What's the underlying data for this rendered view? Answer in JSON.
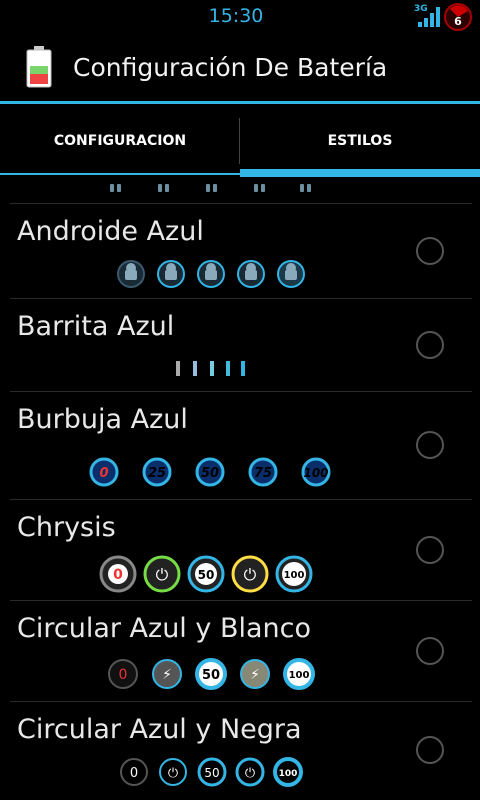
{
  "status_bar": {
    "time": "15:30",
    "network": "3G",
    "notification_count": "6"
  },
  "action_bar": {
    "title": "Configuración De Batería",
    "icon": "battery-icon"
  },
  "tabs": [
    {
      "label": "CONFIGURACION",
      "selected": false
    },
    {
      "label": "ESTILOS",
      "selected": true
    }
  ],
  "styles": [
    {
      "name": "Androide Azul",
      "selected": false,
      "preview": "android-battery-icons"
    },
    {
      "name": "Barrita Azul",
      "selected": false,
      "preview": "bar-icons"
    },
    {
      "name": "Burbuja Azul",
      "selected": false,
      "preview_values": [
        "0",
        "25",
        "50",
        "75",
        "100"
      ]
    },
    {
      "name": "Chrysis",
      "selected": false,
      "preview_values": [
        "0",
        "plug",
        "50",
        "plug",
        "100"
      ]
    },
    {
      "name": "Circular Azul y Blanco",
      "selected": false,
      "preview_values": [
        "0",
        "bolt",
        "50",
        "bolt",
        "100"
      ]
    },
    {
      "name": "Circular Azul y Negra",
      "selected": false,
      "preview_values": [
        "0",
        "plug",
        "50",
        "plug",
        "100"
      ]
    }
  ],
  "colors": {
    "accent": "#33b5e5",
    "background": "#000000"
  }
}
